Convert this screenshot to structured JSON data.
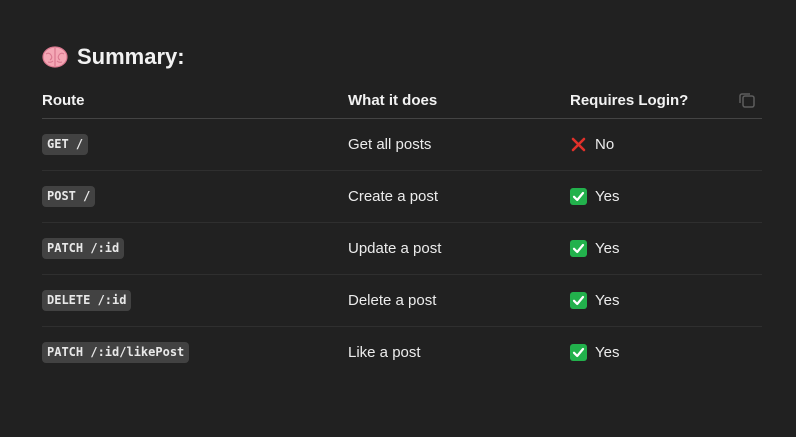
{
  "heading": {
    "icon": "brain-emoji-icon",
    "title": "Summary:"
  },
  "table": {
    "headers": [
      "Route",
      "What it does",
      "Requires Login?"
    ],
    "rows": [
      {
        "route": "GET /",
        "description": "Get all posts",
        "status_icon": "cross-mark-icon",
        "login": "No"
      },
      {
        "route": "POST /",
        "description": "Create a post",
        "status_icon": "check-mark-icon",
        "login": "Yes"
      },
      {
        "route": "PATCH /:id",
        "description": "Update a post",
        "status_icon": "check-mark-icon",
        "login": "Yes"
      },
      {
        "route": "DELETE /:id",
        "description": "Delete a post",
        "status_icon": "check-mark-icon",
        "login": "Yes"
      },
      {
        "route": "PATCH /:id/likePost",
        "description": "Like a post",
        "status_icon": "check-mark-icon",
        "login": "Yes"
      }
    ]
  },
  "colors": {
    "background": "#212121",
    "code_background": "#424242",
    "check_green": "#22b14c",
    "cross_red": "#e0312b"
  }
}
